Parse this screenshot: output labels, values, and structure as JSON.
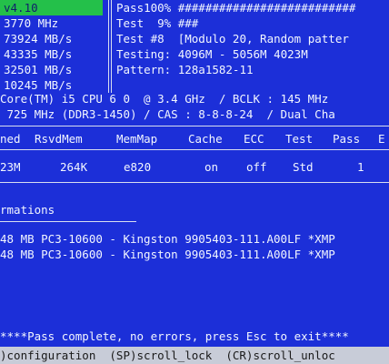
{
  "header": {
    "version": "v4.10",
    "rows": [
      {
        "left": "3770 MHz",
        "right": "Pass100% ##########################"
      },
      {
        "left": "73924 MB/s",
        "right": "Test  9% ###"
      },
      {
        "left": "43335 MB/s",
        "right": "Test #8  [Modulo 20, Random patter"
      },
      {
        "left": "32501 MB/s",
        "right": "Testing: 4096M - 5056M 4023M"
      },
      {
        "left": "10245 MB/s",
        "right": "Pattern: 128a1582-11"
      }
    ]
  },
  "cpu_line": "Core(TM) i5 CPU 6 0  @ 3.4 GHz  / BCLK : 145 MHz",
  "memory_line": " 725 MHz (DDR3-1450) / CAS : 8-8-8-24  / Dual Cha",
  "status_table": {
    "headers": [
      "ned",
      "RsvdMem",
      "MemMap",
      "Cache",
      "ECC",
      "Test",
      "Pass",
      "E"
    ],
    "values": [
      "23M",
      "264K",
      "e820",
      "on",
      "off",
      "Std",
      "1",
      ""
    ]
  },
  "spd_section": {
    "title": "rmations",
    "items": [
      "48 MB PC3-10600 - Kingston 9905403-111.A00LF *XMP",
      "48 MB PC3-10600 - Kingston 9905403-111.A00LF *XMP"
    ]
  },
  "pass_message": "****Pass complete, no errors, press Esc to exit****",
  "bottom_bar": {
    "text": ")configuration  (SP)scroll_lock  (CR)scroll_unloc"
  }
}
